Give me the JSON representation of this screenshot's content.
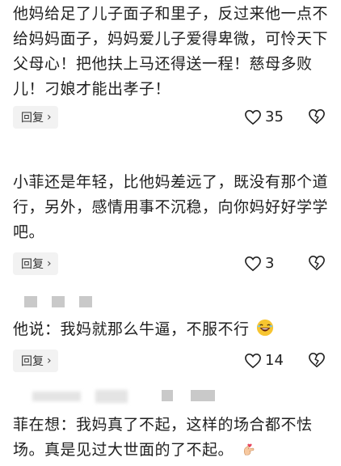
{
  "comments": [
    {
      "text": "他妈给足了儿子面子和里子，反过来他一点不给妈妈面子，妈妈爱儿子爱得卑微，可怜天下父母心！把他扶上马还得送一程！慈母多败儿！刁娘才能出孝子！",
      "reply_label": "回复",
      "likes": "35"
    },
    {
      "text": "小菲还是年轻，比他妈差远了，既没有那个道行，另外，感情用事不沉稳，向你妈好好学学吧。",
      "reply_label": "回复",
      "likes": "3"
    },
    {
      "text": "他说：我妈就那么牛逼，不服不行",
      "reply_label": "回复",
      "likes": "14",
      "emoji": "laughing-face"
    },
    {
      "text": "菲在想：我妈真了不起，这样的场合都不怯场。真是见过大世面的了不起。",
      "emoji": "heart-hands"
    }
  ]
}
